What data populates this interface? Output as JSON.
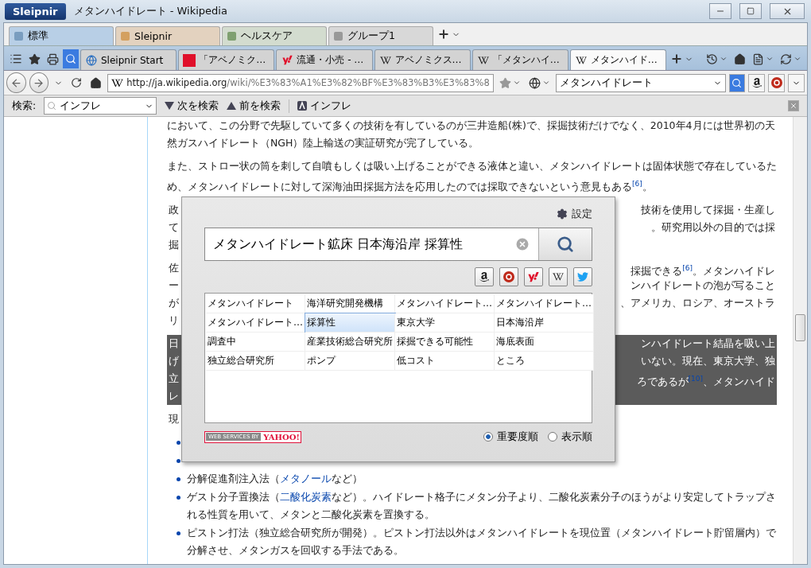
{
  "window": {
    "app_button": "Sleipnir",
    "title": "メタンハイドレート - Wikipedia"
  },
  "tab_groups": [
    {
      "label": "標準",
      "color": "#7a9dbf",
      "selected": true
    },
    {
      "label": "Sleipnir",
      "color": "#d4a060",
      "selected": false
    },
    {
      "label": "ヘルスケア",
      "color": "#7fa070",
      "selected": false
    },
    {
      "label": "グループ1",
      "color": "#999999",
      "selected": false
    }
  ],
  "tabs": [
    {
      "label": "Sleipnir Start",
      "kind": "globe",
      "selected": false
    },
    {
      "label": "「アベノミク…",
      "kind": "red",
      "selected": false
    },
    {
      "label": "流通・小売 - …",
      "kind": "yahoo",
      "selected": false
    },
    {
      "label": "アベノミクス…",
      "kind": "wiki",
      "selected": false
    },
    {
      "label": "「メタンハイ…",
      "kind": "wiki",
      "selected": false
    },
    {
      "label": "メタンハイド…",
      "kind": "wiki",
      "selected": true
    }
  ],
  "address": {
    "host": "http://ja.wikipedia.org",
    "path": "/wiki/%E3%83%A1%E3%82%BF%E3%83%B3%E3%83%8",
    "search": "メタンハイドレート"
  },
  "find_bar": {
    "label": "検索:",
    "query": "インフレ",
    "next": "次を検索",
    "prev": "前を検索",
    "highlight": "インフレ"
  },
  "article": {
    "paragraphs": [
      "において、この分野で先駆していて多くの技術を有しているのが三井造船(株)で、採掘技術だけでなく、2010年4月には世界初の天然ガスハイドレート（NGH）陸上輸送の実証研究が完了している。",
      "また、ストロー状の筒を刺して自噴もしくは吸い上げることができる液体と違い、メタンハイドレートは固体状態で存在しているため、メタンハイドレートに対して深海油田採掘方法を応用したのでは採取できないという意見もある$^{[6]}$。"
    ],
    "covered": [
      {
        "highlighted": false,
        "lines": [
          {
            "left": "政",
            "right": "技術を使用して採掘・生産し"
          },
          {
            "left": "て",
            "right": "。研究用以外の目的では採"
          },
          {
            "left": "掘"
          }
        ]
      },
      {
        "highlighted": false,
        "lines": [
          {
            "left": "佐",
            "right": "採掘できる$^{[6]}$。メタンハイドレ"
          },
          {
            "left": "ー",
            "right": "ンハイドレートの泡が写ること"
          },
          {
            "left": "が",
            "right": "、アメリカ、ロシア、オーストラ"
          },
          {
            "left": "リ"
          }
        ]
      },
      {
        "highlighted": true,
        "lines": [
          {
            "left": "日",
            "right": "ンハイドレート結晶を吸い上"
          },
          {
            "left": "げ",
            "right": "いない。現在、東京大学、独"
          },
          {
            "left": "立",
            "right": "ろであるが$^{[10]}$、メタンハイド"
          },
          {
            "left": "レ"
          }
        ]
      },
      {
        "highlighted": false,
        "lines": [
          {
            "left": "現"
          }
        ]
      }
    ],
    "bullets": [
      {
        "kind": "covered"
      },
      {
        "kind": "covered"
      },
      {
        "kind": "text",
        "parts": [
          {
            "text": "分解促進剤注入法（"
          },
          {
            "text": "メタノール",
            "link": true
          },
          {
            "text": "など）"
          }
        ]
      },
      {
        "kind": "text",
        "parts": [
          {
            "text": "ゲスト分子置換法（"
          },
          {
            "text": "二酸化炭素",
            "link": true
          },
          {
            "text": "など）。ハイドレート格子にメタン分子より、二酸化炭素分子のほうがより安定してトラップされる性質を用いて、メタンと二酸化炭素を置換する。"
          }
        ]
      },
      {
        "kind": "text",
        "parts": [
          {
            "text": "ピストン打法（独立総合研究所が開発）。ピストン打法以外はメタンハイドレートを現位置（メタンハイドレート貯留層内）で分解させ、メタンガスを回収する手法である。"
          }
        ]
      }
    ]
  },
  "popup": {
    "settings": "設定",
    "query": "メタンハイドレート鉱床 日本海沿岸 採算性",
    "services": [
      {
        "kind": "amazon"
      },
      {
        "kind": "rakuten"
      },
      {
        "kind": "yahoo"
      },
      {
        "kind": "wikipedia"
      },
      {
        "kind": "twitter"
      }
    ],
    "keywords": [
      {
        "label": "メタンハイドレート",
        "selected": false
      },
      {
        "label": "海洋研究開発機構",
        "selected": false
      },
      {
        "label": "メタンハイドレート…",
        "selected": false
      },
      {
        "label": "メタンハイドレート…",
        "selected": false
      },
      {
        "label": "メタンハイドレート…",
        "selected": false
      },
      {
        "label": "採算性",
        "selected": true
      },
      {
        "label": "東京大学",
        "selected": false
      },
      {
        "label": "日本海沿岸",
        "selected": false
      },
      {
        "label": "調査中",
        "selected": false
      },
      {
        "label": "産業技術総合研究所",
        "selected": false
      },
      {
        "label": "採掘できる可能性",
        "selected": false
      },
      {
        "label": "海底表面",
        "selected": false
      },
      {
        "label": "独立総合研究所",
        "selected": false
      },
      {
        "label": "ポンプ",
        "selected": false
      },
      {
        "label": "低コスト",
        "selected": false
      },
      {
        "label": "ところ",
        "selected": false
      }
    ],
    "attribution": {
      "by": "WEB SERVICES BY",
      "brand": "YAHOO!"
    },
    "sort": [
      {
        "label": "重要度順",
        "selected": true
      },
      {
        "label": "表示順",
        "selected": false
      }
    ]
  }
}
